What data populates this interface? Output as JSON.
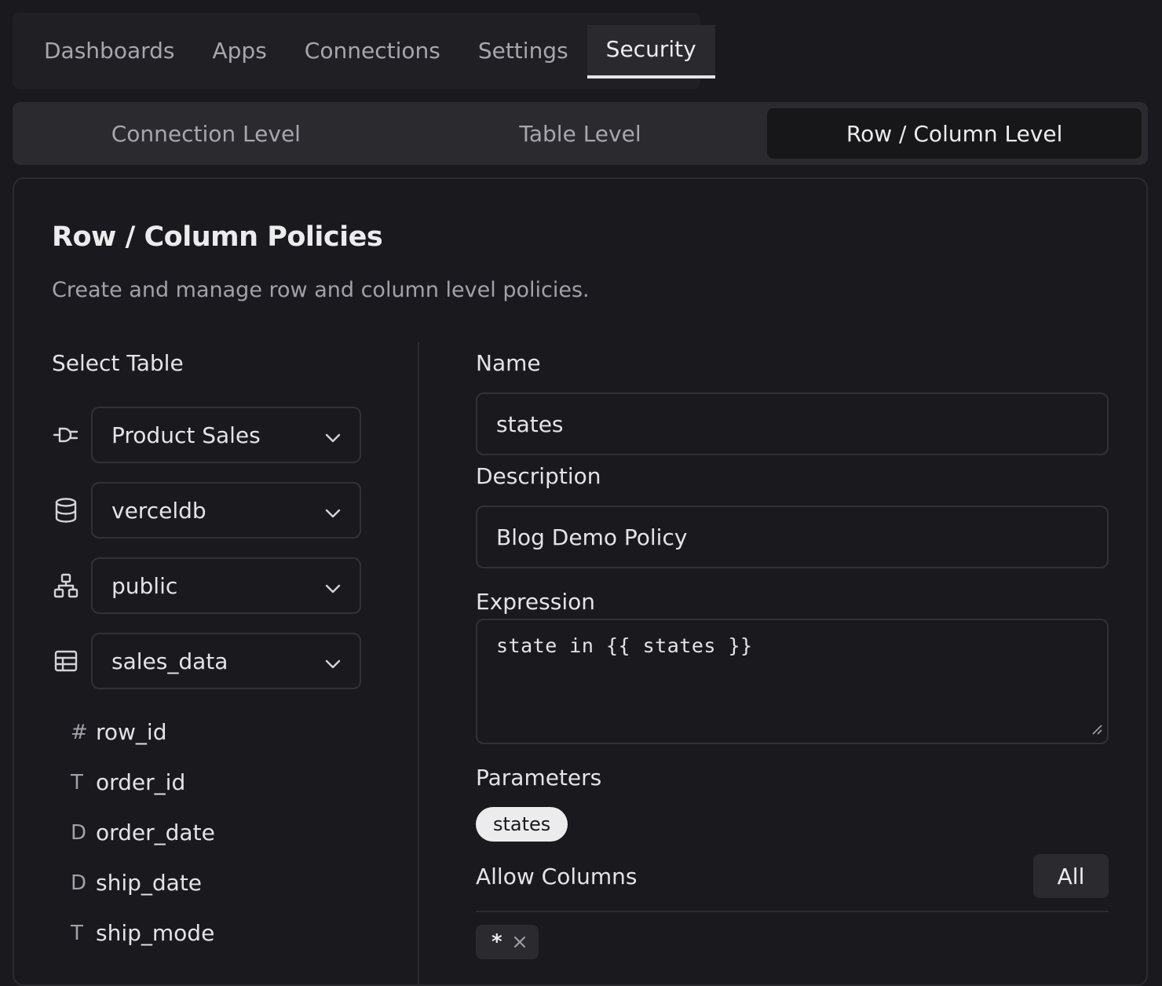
{
  "topnav": {
    "tabs": [
      "Dashboards",
      "Apps",
      "Connections",
      "Settings",
      "Security"
    ]
  },
  "levels": {
    "tabs": [
      "Connection Level",
      "Table Level",
      "Row / Column Level"
    ]
  },
  "card": {
    "title": "Row / Column Policies",
    "subtitle": "Create and manage row and column level policies."
  },
  "left": {
    "select_table_label": "Select Table",
    "selects": [
      {
        "icon": "plug-icon",
        "value": "Product Sales"
      },
      {
        "icon": "database-icon",
        "value": "verceldb"
      },
      {
        "icon": "schema-icon",
        "value": "public"
      },
      {
        "icon": "table-icon",
        "value": "sales_data"
      }
    ],
    "columns": [
      {
        "type": "#",
        "name": "row_id"
      },
      {
        "type": "T",
        "name": "order_id"
      },
      {
        "type": "D",
        "name": "order_date"
      },
      {
        "type": "D",
        "name": "ship_date"
      },
      {
        "type": "T",
        "name": "ship_mode"
      }
    ]
  },
  "form": {
    "name_label": "Name",
    "name_value": "states",
    "description_label": "Description",
    "description_value": "Blog Demo Policy",
    "expression_label": "Expression",
    "expression_value": "state in {{ states }}",
    "parameters_label": "Parameters",
    "parameters": [
      "states"
    ],
    "allow_columns_label": "Allow Columns",
    "all_button": "All",
    "allowed_columns": [
      "*"
    ]
  }
}
